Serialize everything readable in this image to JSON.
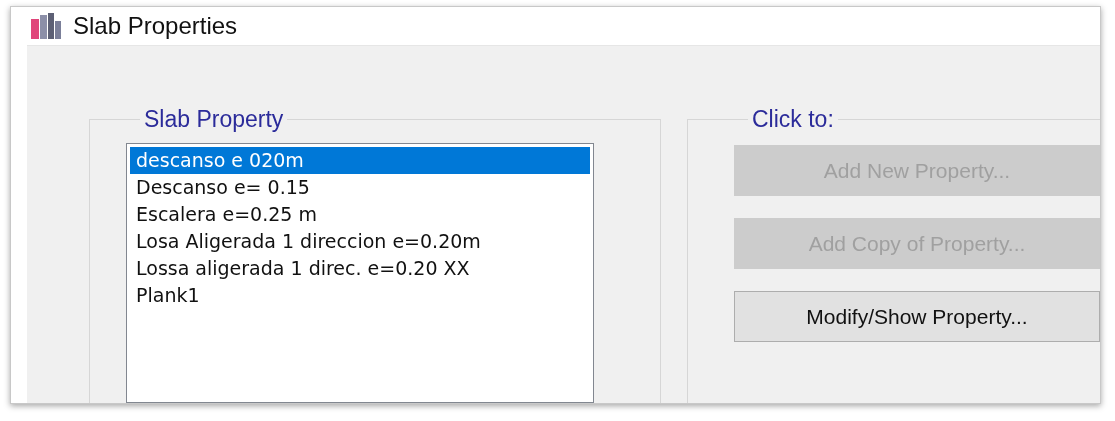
{
  "window": {
    "title": "Slab Properties"
  },
  "slab_property": {
    "title": "Slab Property",
    "items": [
      {
        "label": "descanso e 020m",
        "selected": true
      },
      {
        "label": "Descanso e= 0.15",
        "selected": false
      },
      {
        "label": "Escalera e=0.25 m",
        "selected": false
      },
      {
        "label": "Losa Aligerada 1 direccion e=0.20m",
        "selected": false
      },
      {
        "label": "Lossa aligerada 1 direc. e=0.20 XX",
        "selected": false
      },
      {
        "label": "Plank1",
        "selected": false
      }
    ]
  },
  "click_to": {
    "title": "Click to:",
    "buttons": [
      {
        "label": "Add New Property...",
        "disabled": true
      },
      {
        "label": "Add Copy of Property...",
        "disabled": true
      },
      {
        "label": "Modify/Show Property...",
        "disabled": false
      }
    ]
  }
}
